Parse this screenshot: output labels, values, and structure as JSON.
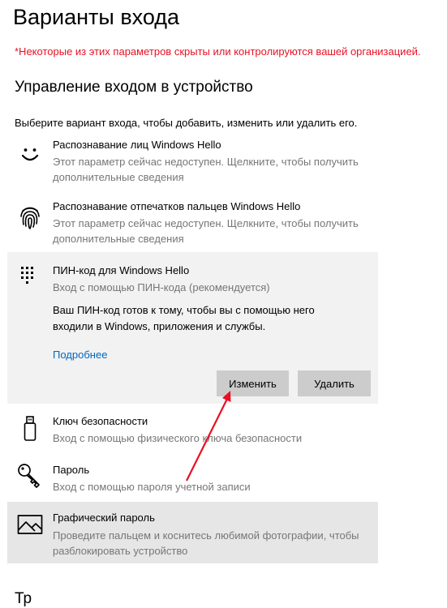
{
  "page": {
    "title": "Варианты входа",
    "warning": "*Некоторые из этих параметров скрыты или контролируются вашей организацией.",
    "section_title": "Управление входом в устройство",
    "intro": "Выберите вариант входа, чтобы добавить, изменить или удалить его.",
    "next_section_partial": "Тр"
  },
  "options": [
    {
      "title": "Распознавание лиц Windows Hello",
      "desc": "Этот параметр сейчас недоступен. Щелкните, чтобы получить дополнительные сведения",
      "icon": "face-icon"
    },
    {
      "title": "Распознавание отпечатков пальцев Windows Hello",
      "desc": "Этот параметр сейчас недоступен. Щелкните, чтобы получить дополнительные сведения",
      "icon": "fingerprint-icon"
    },
    {
      "title": "ПИН-код для Windows Hello",
      "desc": "Вход с помощью ПИН-кода (рекомендуется)",
      "icon": "pin-keypad-icon",
      "details": "Ваш ПИН-код готов к тому, чтобы вы с помощью него входили в Windows, приложения и службы.",
      "link": "Подробнее",
      "change_button": "Изменить",
      "remove_button": "Удалить"
    },
    {
      "title": "Ключ безопасности",
      "desc": "Вход с помощью физического ключа безопасности",
      "icon": "usb-key-icon"
    },
    {
      "title": "Пароль",
      "desc": "Вход с помощью пароля учетной записи",
      "icon": "key-icon"
    },
    {
      "title": "Графический пароль",
      "desc": "Проведите пальцем и коснитесь любимой фотографии, чтобы разблокировать устройство",
      "icon": "picture-icon"
    }
  ],
  "colors": {
    "warning": "#e81123",
    "link": "#0067c0",
    "secondary_text": "#767676",
    "arrow": "#e81123",
    "selected_bg": "#f2f2f2",
    "hover_bg": "#e6e6e6",
    "button_bg": "#cccccc"
  }
}
